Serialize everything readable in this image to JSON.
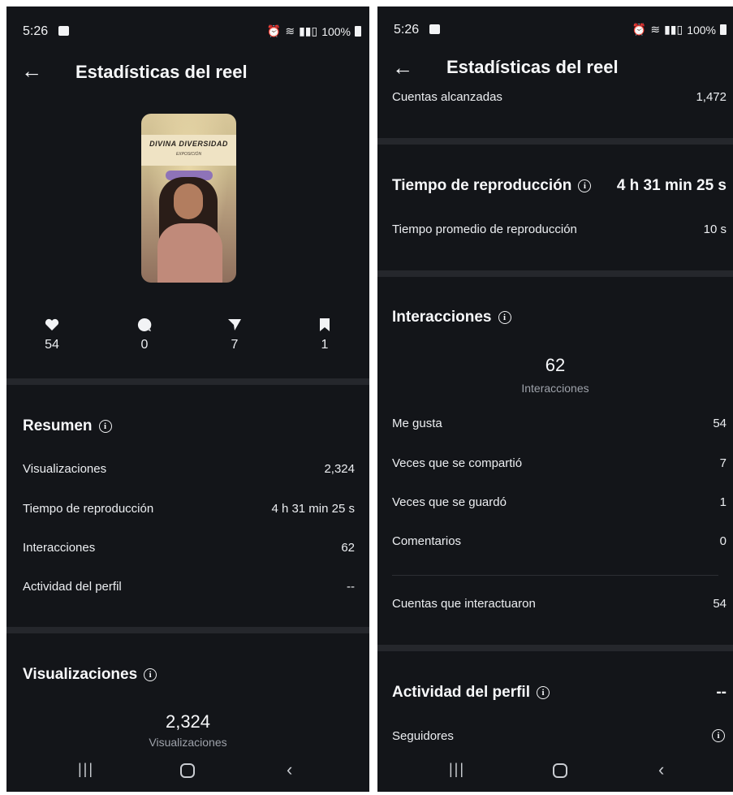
{
  "status_bar": {
    "time": "5:26",
    "battery": "100%"
  },
  "header": {
    "title": "Estadísticas del reel"
  },
  "reel": {
    "thumbnail": {
      "title": "DIVINA DIVERSIDAD",
      "subtitle": "EXPOSICIÓN"
    },
    "counts": {
      "likes": "54",
      "comments": "0",
      "shares": "7",
      "saves": "1"
    }
  },
  "resumen": {
    "title": "Resumen",
    "rows": [
      {
        "label": "Visualizaciones",
        "value": "2,324"
      },
      {
        "label": "Tiempo de reproducción",
        "value": "4 h 31 min 25 s"
      },
      {
        "label": "Interacciones",
        "value": "62"
      },
      {
        "label": "Actividad del perfil",
        "value": "--"
      }
    ]
  },
  "visualizaciones": {
    "title": "Visualizaciones",
    "value": "2,324",
    "caption": "Visualizaciones"
  },
  "right": {
    "reach": {
      "label": "Cuentas alcanzadas",
      "value": "1,472"
    },
    "playtime": {
      "title": "Tiempo de reproducción",
      "value": "4 h 31 min 25 s",
      "avg_label": "Tiempo promedio de reproducción",
      "avg_value": "10 s"
    },
    "interacciones": {
      "title": "Interacciones",
      "total": "62",
      "caption": "Interacciones",
      "rows": [
        {
          "label": "Me gusta",
          "value": "54"
        },
        {
          "label": "Veces que se compartió",
          "value": "7"
        },
        {
          "label": "Veces que se guardó",
          "value": "1"
        },
        {
          "label": "Comentarios",
          "value": "0"
        }
      ],
      "accounts_label": "Cuentas que interactuaron",
      "accounts_value": "54"
    },
    "actividad": {
      "title": "Actividad del perfil",
      "value": "--",
      "followers_label": "Seguidores"
    }
  },
  "icons": {
    "back": "arrow-left-icon",
    "info": "info-icon",
    "like": "heart-icon",
    "comment": "comment-icon",
    "share": "send-icon",
    "save": "bookmark-icon",
    "nav_recent": "recents-icon",
    "nav_home": "home-icon",
    "nav_back": "chevron-left-icon"
  },
  "colors": {
    "background": "#131519",
    "divider": "#25272c",
    "text": "#f2f3f5",
    "muted": "#9ea2aa"
  }
}
